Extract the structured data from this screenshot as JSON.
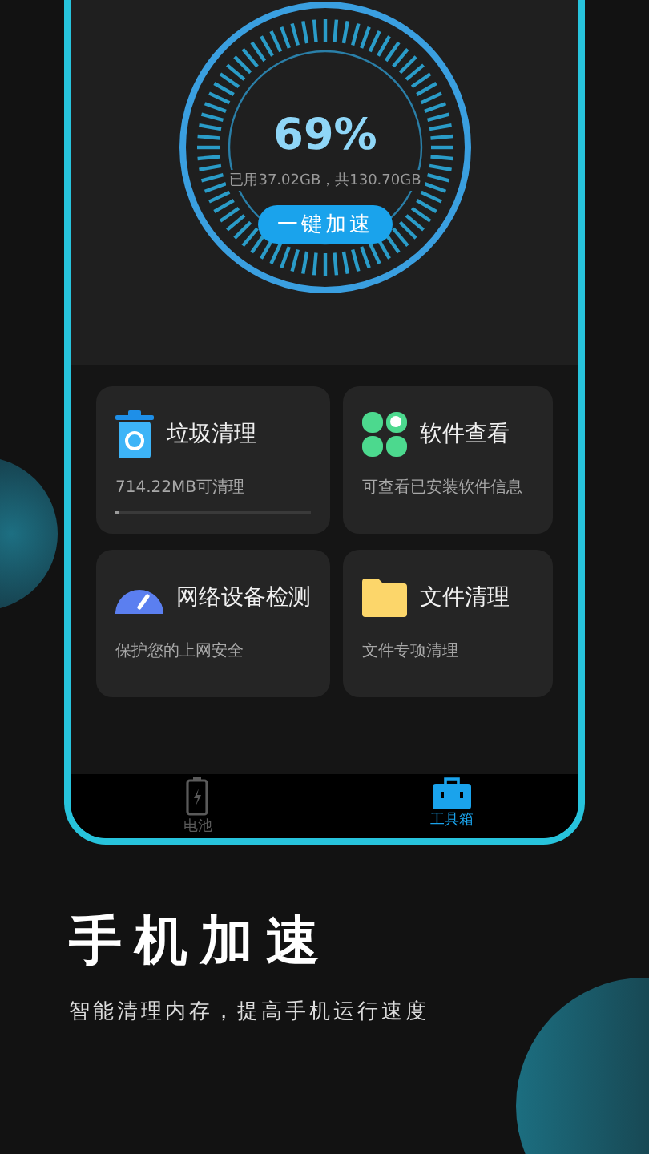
{
  "gauge": {
    "percent": "69%",
    "usage": "已用37.02GB，共130.70GB",
    "button": "一键加速"
  },
  "tools": [
    {
      "kind": "trash",
      "title": "垃圾清理",
      "subtitle": "714.22MB可清理",
      "level": 0.02
    },
    {
      "kind": "apps",
      "title": "软件查看",
      "subtitle": "可查看已安装软件信息"
    },
    {
      "kind": "network",
      "title": "网络设备检测",
      "subtitle": "保护您的上网安全"
    },
    {
      "kind": "folder",
      "title": "文件清理",
      "subtitle": "文件专项清理"
    }
  ],
  "nav": [
    {
      "kind": "battery",
      "label": "电池",
      "selected": false
    },
    {
      "kind": "toolbox",
      "label": "工具箱",
      "selected": true
    }
  ],
  "headline": "手机加速",
  "tagline": "智能清理内存，提高手机运行速度"
}
